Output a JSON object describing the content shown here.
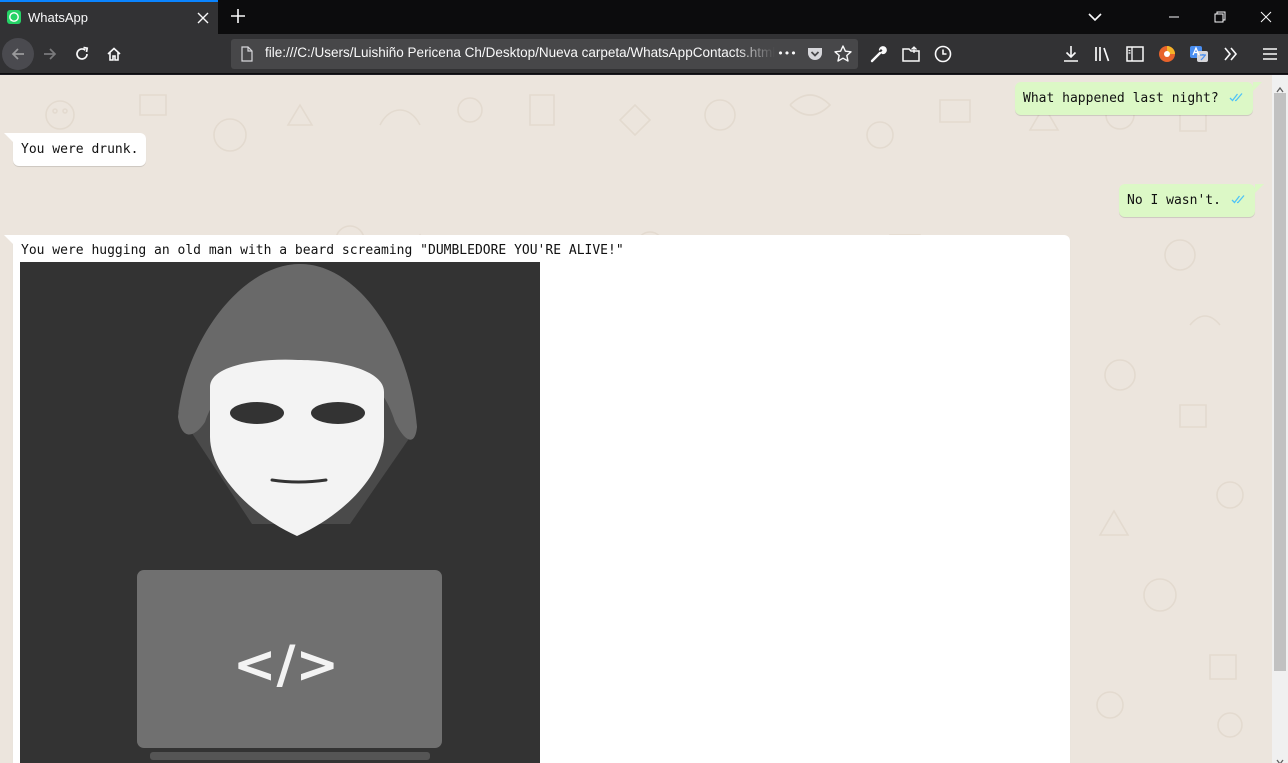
{
  "browser": {
    "tab_title": "WhatsApp",
    "url": "file:///C:/Users/Luishiño Pericena Ch/Desktop/Nueva carpeta/WhatsAppContacts.html",
    "url_more_glyph": "•••"
  },
  "chat": {
    "messages": [
      {
        "direction": "outgoing",
        "text": "What happened last night?",
        "status": "read"
      },
      {
        "direction": "incoming",
        "text": "You were drunk."
      },
      {
        "direction": "outgoing",
        "text": "No I wasn't.",
        "status": "read"
      },
      {
        "direction": "incoming",
        "text": "You were hugging an old man with a beard screaming \"DUMBLEDORE YOU'RE ALIVE!\"",
        "image": {
          "laptop_code_text": "</>"
        }
      }
    ]
  },
  "colors": {
    "accent": "#0a84ff",
    "outgoing_bubble": "#dcf8c6",
    "incoming_bubble": "#ffffff",
    "chat_background": "#ece5dd",
    "read_ticks": "#4fc3f7"
  }
}
